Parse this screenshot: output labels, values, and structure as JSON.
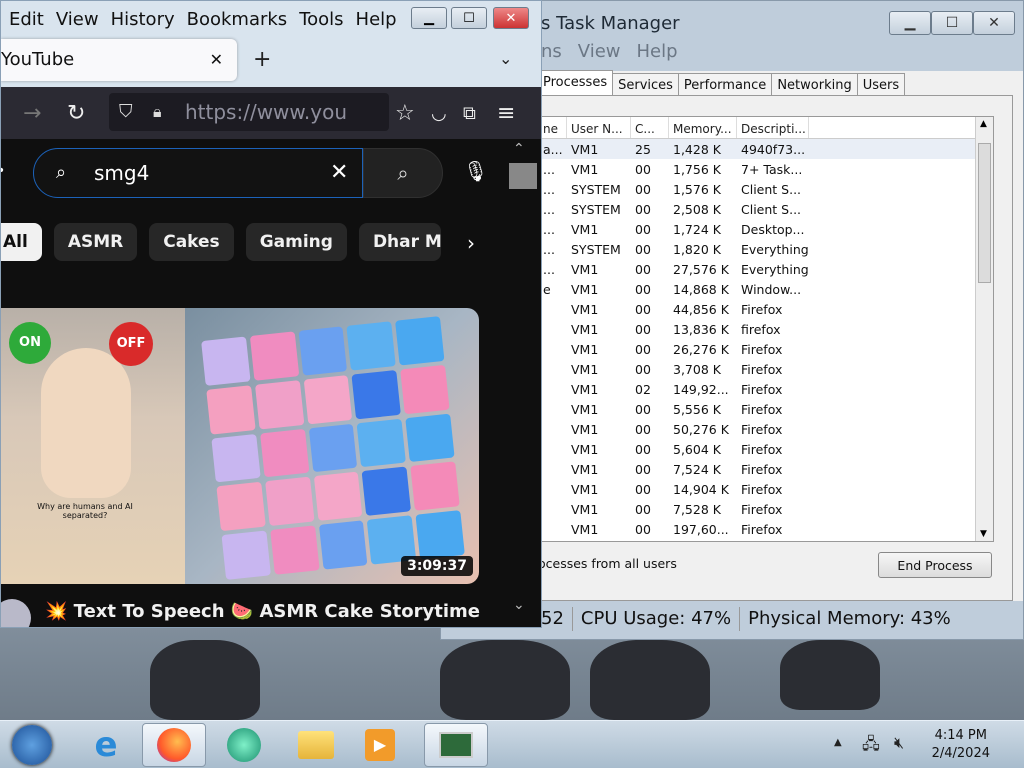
{
  "firefox": {
    "menu": [
      "Edit",
      "View",
      "History",
      "Bookmarks",
      "Tools",
      "Help"
    ],
    "tab_title": "YouTube",
    "url": "https://www.you",
    "search_value": "smg4",
    "chips": [
      "All",
      "ASMR",
      "Cakes",
      "Gaming",
      "Dhar Ma"
    ],
    "video": {
      "duration": "3:09:37",
      "title": "💥 Text To Speech 🍉 ASMR Cake Storytime",
      "on_label": "ON",
      "off_label": "OFF",
      "caption": "Why are humans and AI separated?"
    }
  },
  "taskmanager": {
    "title": "s Task Manager",
    "menu": [
      "ns",
      "View",
      "Help"
    ],
    "tabs": [
      "Processes",
      "Services",
      "Performance",
      "Networking",
      "Users"
    ],
    "columns": [
      "ne",
      "User N...",
      "C...",
      "Memory...",
      "Descripti..."
    ],
    "rows": [
      [
        "a...",
        "VM1",
        "25",
        "1,428 K",
        "4940f73..."
      ],
      [
        "...",
        "VM1",
        "00",
        "1,756 K",
        "7+ Task..."
      ],
      [
        "...",
        "SYSTEM",
        "00",
        "1,576 K",
        "Client S..."
      ],
      [
        "...",
        "SYSTEM",
        "00",
        "2,508 K",
        "Client S..."
      ],
      [
        "...",
        "VM1",
        "00",
        "1,724 K",
        "Desktop..."
      ],
      [
        "...",
        "SYSTEM",
        "00",
        "1,820 K",
        "Everything"
      ],
      [
        "...",
        "VM1",
        "00",
        "27,576 K",
        "Everything"
      ],
      [
        "e",
        "VM1",
        "00",
        "14,868 K",
        "Window..."
      ],
      [
        "",
        "VM1",
        "00",
        "44,856 K",
        "Firefox"
      ],
      [
        "",
        "VM1",
        "00",
        "13,836 K",
        "firefox"
      ],
      [
        "",
        "VM1",
        "00",
        "26,276 K",
        "Firefox"
      ],
      [
        "",
        "VM1",
        "00",
        "3,708 K",
        "Firefox"
      ],
      [
        "",
        "VM1",
        "02",
        "149,92...",
        "Firefox"
      ],
      [
        "",
        "VM1",
        "00",
        "5,556 K",
        "Firefox"
      ],
      [
        "",
        "VM1",
        "00",
        "50,276 K",
        "Firefox"
      ],
      [
        "",
        "VM1",
        "00",
        "5,604 K",
        "Firefox"
      ],
      [
        "",
        "VM1",
        "00",
        "7,524 K",
        "Firefox"
      ],
      [
        "",
        "VM1",
        "00",
        "14,904 K",
        "Firefox"
      ],
      [
        "",
        "VM1",
        "00",
        "7,528 K",
        "Firefox"
      ],
      [
        "",
        "VM1",
        "00",
        "197,60...",
        "Firefox"
      ]
    ],
    "show_all_label": "ocesses from all users",
    "end_process": "End Process",
    "status": {
      "processes": "52",
      "cpu": "CPU Usage: 47%",
      "memory": "Physical Memory: 43%"
    }
  },
  "taskbar": {
    "time": "4:14 PM",
    "date": "2/4/2024"
  }
}
